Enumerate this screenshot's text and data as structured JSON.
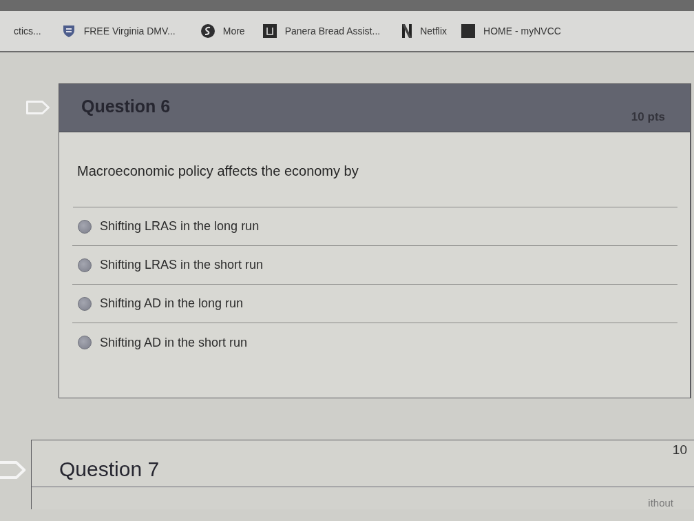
{
  "bookmarks_bar": {
    "items": [
      {
        "label": "ctics..."
      },
      {
        "label": "FREE Virginia DMV..."
      },
      {
        "label": "More"
      },
      {
        "label": "Panera Bread Assist..."
      },
      {
        "label": "Netflix"
      },
      {
        "label": "HOME - myNVCC"
      }
    ]
  },
  "questions": [
    {
      "title": "Question 6",
      "points": "10 pts",
      "prompt": "Macroeconomic policy affects the economy by",
      "answers": [
        {
          "label": "Shifting LRAS in the long run",
          "selected": false
        },
        {
          "label": "Shifting LRAS in the short run",
          "selected": false
        },
        {
          "label": "Shifting AD in the long run",
          "selected": false
        },
        {
          "label": "Shifting AD in the short run",
          "selected": false
        }
      ]
    },
    {
      "title": "Question 7",
      "points": "10",
      "body_text": "ithout"
    }
  ]
}
